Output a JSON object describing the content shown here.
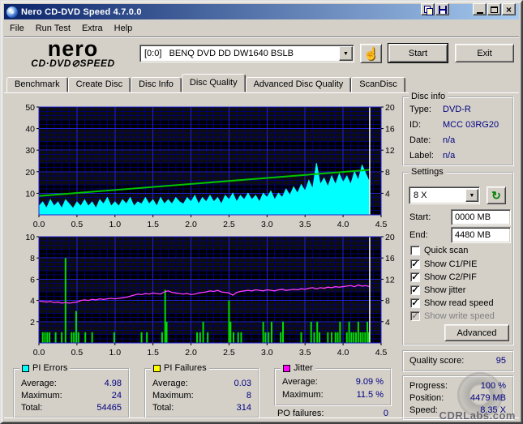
{
  "window": {
    "title": "Nero CD-DVD Speed 4.7.0.0"
  },
  "menu": {
    "items": [
      "File",
      "Run Test",
      "Extra",
      "Help"
    ]
  },
  "toolbar": {
    "logo_line1": "nero",
    "logo_line2": "CD·DVD⊘SPEED",
    "drive_selector_value": "[0:0]   BENQ DVD DD DW1640 BSLB",
    "start_label": "Start",
    "exit_label": "Exit"
  },
  "icons": {
    "close": "×",
    "dropdown": "▼",
    "eject_hand": "☝",
    "refresh": "↻",
    "check": "✓"
  },
  "tabs": {
    "items": [
      "Benchmark",
      "Create Disc",
      "Disc Info",
      "Disc Quality",
      "Advanced Disc Quality",
      "ScanDisc"
    ],
    "active": "Disc Quality"
  },
  "disc_info": {
    "title": "Disc info",
    "rows": [
      {
        "label": "Type:",
        "value": "DVD-R"
      },
      {
        "label": "ID:",
        "value": "MCC 03RG20"
      },
      {
        "label": "Date:",
        "value": "n/a"
      },
      {
        "label": "Label:",
        "value": "n/a"
      }
    ]
  },
  "settings": {
    "title": "Settings",
    "speed_value": "8 X",
    "start_label": "Start:",
    "start_value": "0000 MB",
    "end_label": "End:",
    "end_value": "4480 MB",
    "checkboxes": [
      {
        "label": "Quick scan",
        "checked": false,
        "disabled": false
      },
      {
        "label": "Show C1/PIE",
        "checked": true,
        "disabled": false
      },
      {
        "label": "Show C2/PIF",
        "checked": true,
        "disabled": false
      },
      {
        "label": "Show jitter",
        "checked": true,
        "disabled": false
      },
      {
        "label": "Show read speed",
        "checked": true,
        "disabled": false
      },
      {
        "label": "Show write speed",
        "checked": true,
        "disabled": true
      }
    ],
    "advanced_label": "Advanced"
  },
  "quality": {
    "label": "Quality score:",
    "value": "95"
  },
  "progress": {
    "rows": [
      {
        "label": "Progress:",
        "value": "100 %"
      },
      {
        "label": "Position:",
        "value": "4479 MB"
      },
      {
        "label": "Speed:",
        "value": "8.35 X"
      }
    ]
  },
  "stats": {
    "boxes": [
      {
        "title": "PI Errors",
        "color": "#00FFFF",
        "rows": [
          {
            "label": "Average:",
            "value": "4.98"
          },
          {
            "label": "Maximum:",
            "value": "24"
          },
          {
            "label": "Total:",
            "value": "54465"
          }
        ]
      },
      {
        "title": "PI Failures",
        "color": "#FFFF00",
        "rows": [
          {
            "label": "Average:",
            "value": "0.03"
          },
          {
            "label": "Maximum:",
            "value": "8"
          },
          {
            "label": "Total:",
            "value": "314"
          }
        ]
      },
      {
        "title": "Jitter",
        "color": "#FF00FF",
        "rows": [
          {
            "label": "Average:",
            "value": "9.09 %"
          },
          {
            "label": "Maximum:",
            "value": "11.5 %"
          }
        ]
      }
    ],
    "po_failures": {
      "label": "PO failures:",
      "value": "0"
    }
  },
  "watermark": "CDRLabs.com",
  "chart_data": [
    {
      "type": "area",
      "title": "PI Errors / Read speed vs position (GB)",
      "x_range": [
        0,
        4.5
      ],
      "x_ticks": [
        0,
        0.5,
        1,
        1.5,
        2,
        2.5,
        3,
        3.5,
        4,
        4.5
      ],
      "x_tick_labels": [
        "0.0",
        "0.5",
        "1.0",
        "1.5",
        "2.0",
        "2.5",
        "3.0",
        "3.5",
        "4.0",
        "4.5"
      ],
      "x_major_step": 0.5,
      "x_minor_step": 0.1,
      "left_axis": {
        "range": [
          0,
          50
        ],
        "ticks": [
          10,
          20,
          30,
          40,
          50
        ],
        "major_step": 10,
        "minor_step": 2
      },
      "right_axis": {
        "range": [
          0,
          20
        ],
        "ticks": [
          4,
          8,
          12,
          16,
          20
        ]
      },
      "grid": true,
      "legend_position": "none",
      "position_marker_x": 4.35,
      "series": [
        {
          "name": "PI Errors",
          "type": "area",
          "axis": "left",
          "color": "#00FFFF",
          "x_start": 0,
          "x_step": 0.05,
          "values": [
            4,
            6,
            3,
            7,
            4,
            6,
            3,
            7,
            5,
            3,
            6,
            4,
            7,
            4,
            6,
            3,
            7,
            5,
            8,
            4,
            6,
            4,
            7,
            5,
            8,
            4,
            6,
            5,
            8,
            5,
            7,
            4,
            8,
            5,
            7,
            5,
            8,
            6,
            5,
            8,
            6,
            9,
            5,
            8,
            6,
            9,
            6,
            8,
            5,
            9,
            7,
            10,
            6,
            9,
            7,
            10,
            7,
            9,
            6,
            10,
            8,
            11,
            7,
            10,
            8,
            12,
            9,
            13,
            10,
            14,
            11,
            16,
            12,
            24,
            14,
            17,
            13,
            18,
            14,
            19,
            15,
            18,
            14,
            20,
            16,
            23,
            19,
            15
          ]
        },
        {
          "name": "Read speed",
          "type": "line",
          "axis": "right",
          "color": "#00C400",
          "stroke_width": 2,
          "points": [
            [
              0,
              3.5
            ],
            [
              4.35,
              8.35
            ]
          ]
        }
      ]
    },
    {
      "type": "bar",
      "title": "PI Failures / Jitter vs position (GB)",
      "x_range": [
        0,
        4.5
      ],
      "x_ticks": [
        0,
        0.5,
        1,
        1.5,
        2,
        2.5,
        3,
        3.5,
        4,
        4.5
      ],
      "x_tick_labels": [
        "0.0",
        "0.5",
        "1.0",
        "1.5",
        "2.0",
        "2.5",
        "3.0",
        "3.5",
        "4.0",
        "4.5"
      ],
      "x_major_step": 0.5,
      "x_minor_step": 0.1,
      "left_axis": {
        "range": [
          0,
          10
        ],
        "ticks": [
          2,
          4,
          6,
          8,
          10
        ],
        "major_step": 2,
        "minor_step": 0.4
      },
      "right_axis": {
        "range": [
          0,
          20
        ],
        "ticks": [
          4,
          8,
          12,
          16,
          20
        ]
      },
      "grid": true,
      "legend_position": "none",
      "position_marker_x": 4.35,
      "series": [
        {
          "name": "PI Failures",
          "type": "bars",
          "axis": "left",
          "color": "#00DC00",
          "points": [
            [
              0.05,
              1
            ],
            [
              0.08,
              1
            ],
            [
              0.11,
              1
            ],
            [
              0.14,
              1
            ],
            [
              0.22,
              1
            ],
            [
              0.3,
              1
            ],
            [
              0.35,
              8
            ],
            [
              0.43,
              1
            ],
            [
              0.46,
              1
            ],
            [
              0.49,
              3
            ],
            [
              0.52,
              1
            ],
            [
              0.61,
              1
            ],
            [
              0.7,
              1
            ],
            [
              0.99,
              1
            ],
            [
              1.35,
              1
            ],
            [
              1.42,
              1
            ],
            [
              1.62,
              1
            ],
            [
              1.66,
              5
            ],
            [
              1.68,
              2
            ],
            [
              2.08,
              1
            ],
            [
              2.12,
              1
            ],
            [
              2.16,
              2
            ],
            [
              2.22,
              1
            ],
            [
              2.5,
              4
            ],
            [
              2.52,
              2
            ],
            [
              2.56,
              1
            ],
            [
              2.62,
              1
            ],
            [
              2.66,
              1
            ],
            [
              2.95,
              2
            ],
            [
              2.98,
              1
            ],
            [
              3.02,
              1
            ],
            [
              3.06,
              2
            ],
            [
              3.18,
              1
            ],
            [
              3.21,
              2
            ],
            [
              3.45,
              1
            ],
            [
              3.58,
              2
            ],
            [
              3.62,
              1
            ],
            [
              3.66,
              2
            ],
            [
              3.69,
              1
            ],
            [
              3.8,
              1
            ],
            [
              3.85,
              1
            ],
            [
              3.9,
              1
            ],
            [
              3.93,
              1
            ],
            [
              3.96,
              2
            ],
            [
              4.05,
              1
            ],
            [
              4.08,
              2
            ],
            [
              4.11,
              1
            ],
            [
              4.14,
              1
            ],
            [
              4.17,
              1
            ],
            [
              4.2,
              2
            ],
            [
              4.23,
              1
            ],
            [
              4.26,
              1
            ],
            [
              4.29,
              1
            ],
            [
              4.32,
              2
            ],
            [
              4.34,
              1
            ]
          ]
        },
        {
          "name": "Jitter",
          "type": "line",
          "axis": "right",
          "color": "#FF3CFF",
          "stroke_width": 1.3,
          "x_start": 0,
          "x_step": 0.05,
          "values": [
            7.9,
            7.8,
            7.7,
            7.8,
            7.6,
            7.7,
            7.5,
            7.6,
            7.5,
            7.6,
            7.7,
            8.0,
            8.1,
            8.0,
            8.2,
            8.1,
            8.3,
            8.2,
            8.3,
            8.4,
            8.3,
            8.4,
            8.5,
            8.6,
            8.8,
            9.0,
            9.2,
            9.1,
            9.3,
            9.2,
            9.4,
            9.3,
            9.2,
            9.6,
            9.8,
            9.5,
            9.4,
            9.3,
            9.2,
            9.3,
            9.1,
            9.2,
            9.4,
            9.5,
            9.6,
            9.8,
            9.7,
            9.9,
            9.6,
            9.5,
            9.4,
            9.0,
            9.5,
            9.7,
            9.8,
            9.9,
            9.8,
            10.0,
            9.9,
            9.8,
            10.0,
            9.9,
            9.8,
            10.0,
            10.1,
            9.9,
            10.0,
            10.1,
            10.0,
            10.2,
            10.1,
            10.3,
            10.4,
            10.2,
            10.4,
            10.3,
            10.5,
            10.4,
            10.6,
            10.5,
            10.6,
            10.7,
            10.8,
            10.6,
            10.9,
            10.7,
            10.8,
            10.6
          ]
        }
      ]
    }
  ]
}
